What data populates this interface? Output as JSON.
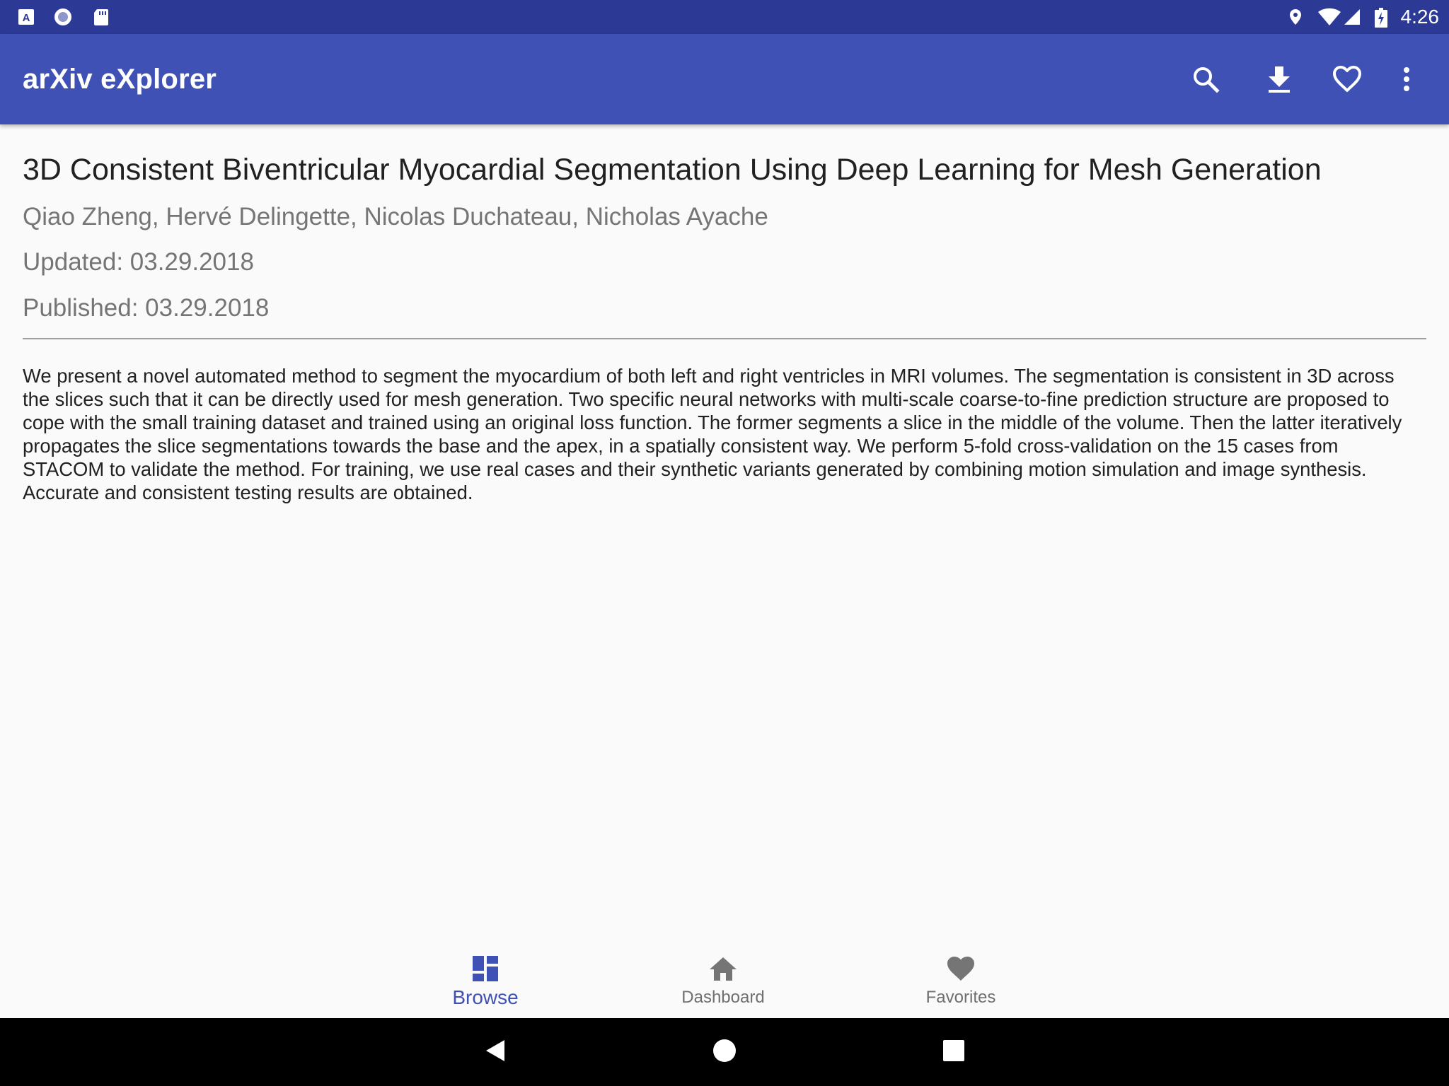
{
  "status_bar": {
    "time": "4:26",
    "left_icons": [
      "a-box-icon",
      "circle-icon",
      "sd-card-icon"
    ],
    "right_icons": [
      "location-icon",
      "wifi-icon",
      "signal-icon",
      "battery-icon"
    ]
  },
  "app_bar": {
    "title": "arXiv eXplorer",
    "actions": [
      "search-icon",
      "download-icon",
      "heart-outline-icon",
      "more-vert-icon"
    ]
  },
  "paper": {
    "title": "3D Consistent Biventricular Myocardial Segmentation Using Deep Learning for Mesh Generation",
    "authors": "Qiao Zheng, Hervé Delingette, Nicolas Duchateau, Nicholas Ayache",
    "updated": "Updated: 03.29.2018",
    "published": "Published: 03.29.2018",
    "abstract": "We present a novel automated method to segment the myocardium of both left and right ventricles in MRI volumes. The segmentation is consistent in 3D across the slices such that it can be directly used for mesh generation. Two specific neural networks with multi-scale coarse-to-fine prediction structure are proposed to cope with the small training dataset and trained using an original loss function. The former segments a slice in the middle of the volume. Then the latter iteratively propagates the slice segmentations towards the base and the apex, in a spatially consistent way. We perform 5-fold cross-validation on the 15 cases from STACOM to validate the method. For training, we use real cases and their synthetic variants generated by combining motion simulation and image synthesis. Accurate and consistent testing results are obtained."
  },
  "bottom_nav": {
    "items": [
      {
        "label": "Browse",
        "icon": "dashboard-grid-icon",
        "active": true
      },
      {
        "label": "Dashboard",
        "icon": "home-icon",
        "active": false
      },
      {
        "label": "Favorites",
        "icon": "heart-icon",
        "active": false
      }
    ]
  },
  "system_nav": [
    "back-icon",
    "home-circle-icon",
    "recents-square-icon"
  ],
  "colors": {
    "status_bar": "#2c3a96",
    "app_bar": "#3f51b5",
    "accent_active": "#3f51b5",
    "inactive": "#6f6f6f",
    "background": "#fafafa"
  }
}
